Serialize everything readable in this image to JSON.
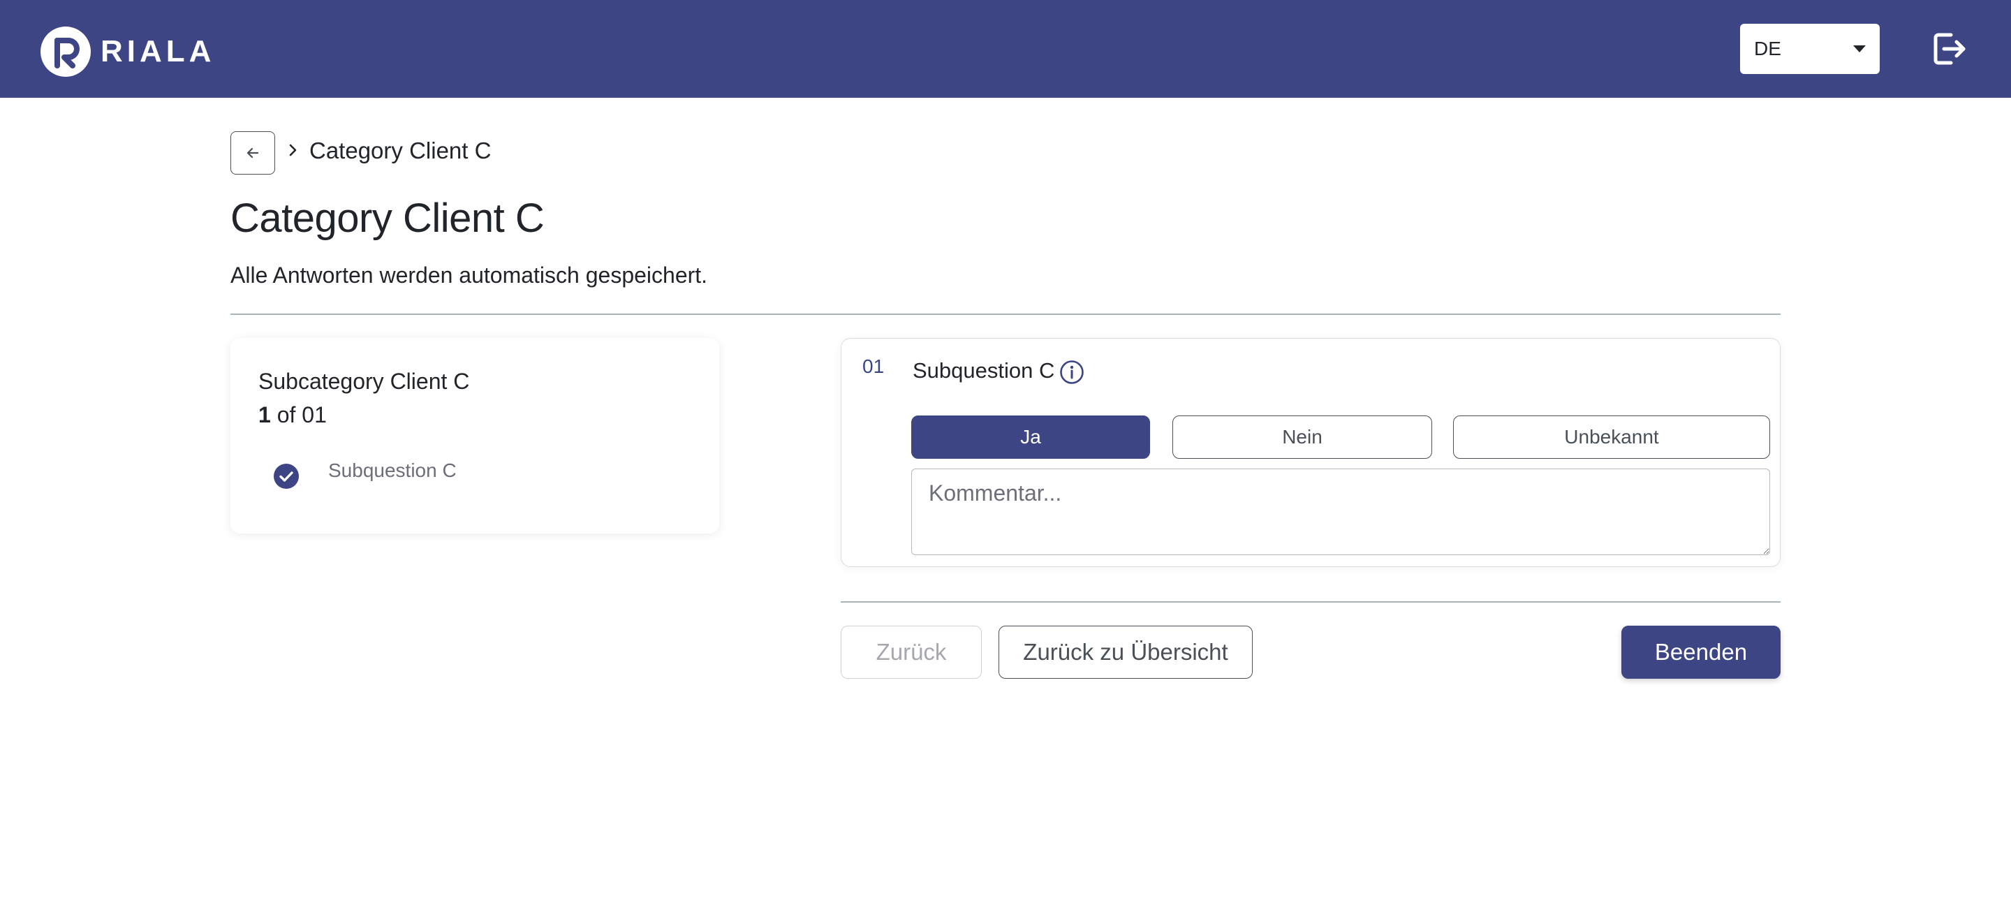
{
  "header": {
    "brand": "RIALA",
    "language": {
      "selected": "DE"
    },
    "colors": {
      "primary": "#3d4585"
    },
    "logout_icon": "logout-icon"
  },
  "breadcrumb": {
    "current": "Category Client C",
    "back_icon": "arrow-left-icon"
  },
  "page": {
    "title": "Category Client C",
    "autosave_note": "Alle Antworten werden automatisch gespeichert."
  },
  "sidebar": {
    "subcategory": "Subcategory Client C",
    "progress_current": "1",
    "progress_rest": " of 01",
    "items": [
      {
        "label": "Subquestion C",
        "status": "answered",
        "icon": "check-circle-icon"
      }
    ]
  },
  "question": {
    "number": "01",
    "title": "Subquestion C",
    "info_icon": "info-icon",
    "options": [
      {
        "label": "Ja",
        "selected": true
      },
      {
        "label": "Nein",
        "selected": false
      },
      {
        "label": "Unbekannt",
        "selected": false
      }
    ],
    "comment_placeholder": "Kommentar...",
    "comment_value": ""
  },
  "actions": {
    "prev_label": "Zurück",
    "overview_label": "Zurück zu Übersicht",
    "finish_label": "Beenden"
  }
}
